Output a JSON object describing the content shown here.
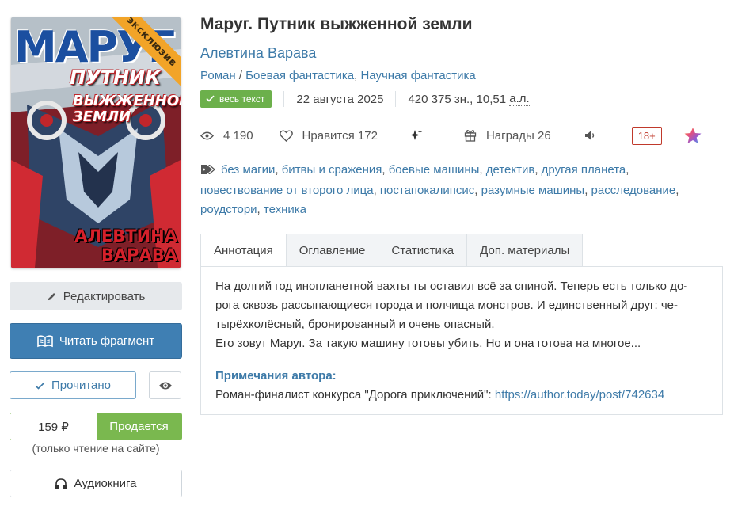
{
  "book": {
    "title": "Маруг. Путник выжженной земли",
    "author": "Алевтина Варава",
    "genres": [
      "Роман",
      "Боевая фантастика",
      "Научная фантастика"
    ],
    "full_text_badge": "весь текст",
    "date": "22 августа 2025",
    "size_chars": "420 375 зн.,",
    "size_sheets": "10,51",
    "size_unit": "а.л."
  },
  "cover": {
    "title_1": "МАРУГ",
    "title_2": "ПУТНИК",
    "title_3a": "ВЫЖЖЕННОЙ",
    "title_3b": "ЗЕМЛИ",
    "author_1": "АЛЕВТИНА",
    "author_2": "ВАРАВА",
    "ribbon": "эксклюзив"
  },
  "stats": {
    "views": "4 190",
    "likes_label": "Нравится",
    "likes": "172",
    "awards_label": "Награды",
    "awards": "26",
    "age": "18+"
  },
  "tags": [
    "без магии",
    "битвы и сражения",
    "боевые машины",
    "детектив",
    "другая планета",
    "повествование от второго лица",
    "постапокалипсис",
    "разумные машины",
    "расследование",
    "роудстори",
    "техника"
  ],
  "sidebar": {
    "edit": "Редактировать",
    "read_fragment": "Читать фрагмент",
    "read_done": "Прочитано",
    "price": "159 ₽",
    "on_sale": "Продается",
    "price_note": "(только чтение на сайте)",
    "audiobook": "Аудиокнига"
  },
  "tabs": [
    "Аннотация",
    "Оглавление",
    "Статистика",
    "Доп. материалы"
  ],
  "annotation": {
    "line1": "На долгий год инопланетной вахты ты оставил всё за спиной. Теперь есть только до-",
    "line2": "рога сквозь рассыпающиеся города и полчища монстров. И единственный друг: че-",
    "line3": "тырёхколёсный, бронированный и очень опасный.",
    "line4": "Его зовут Маруг. За такую машину готовы убить. Но и она готова на многое...",
    "notes_heading": "Примечания автора:",
    "notes_text": "Роман-финалист конкурса \"Дорога приключений\": ",
    "notes_link": "https://author.today/post/742634"
  },
  "colors": {
    "accent_blue": "#3d7aa8",
    "read_button": "#3f7fb3",
    "green": "#7ab84f",
    "ribbon": "#f2a428",
    "age_red": "#c0392b"
  }
}
